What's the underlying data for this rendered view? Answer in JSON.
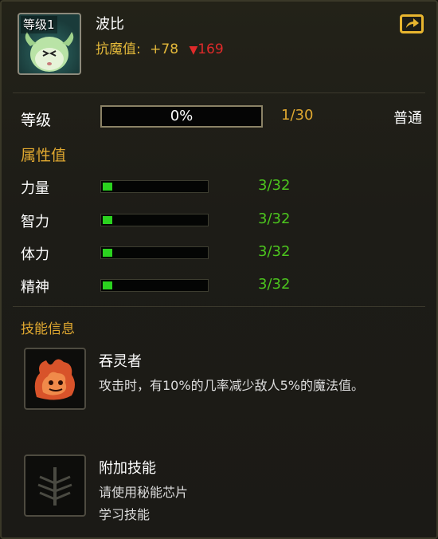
{
  "pet": {
    "level_badge": "等级1",
    "name": "波比",
    "resist_label": "抗魔值:",
    "resist_bonus": "+78",
    "resist_decrease": "169"
  },
  "level": {
    "label": "等级",
    "exp_percent_text": "0%",
    "exp_fraction": 0,
    "progress": "1/30",
    "quality": "普通"
  },
  "attributes": {
    "title": "属性值",
    "items": [
      {
        "label": "力量",
        "value": "3/32",
        "fraction": 0.09375
      },
      {
        "label": "智力",
        "value": "3/32",
        "fraction": 0.09375
      },
      {
        "label": "体力",
        "value": "3/32",
        "fraction": 0.09375
      },
      {
        "label": "精神",
        "value": "3/32",
        "fraction": 0.09375
      }
    ]
  },
  "skills": {
    "title": "技能信息",
    "primary": {
      "name": "吞灵者",
      "description": "攻击时，有10%的几率减少敌人5%的魔法值。",
      "icon": "flame-creature-icon"
    },
    "extra": {
      "name": "附加技能",
      "line1": "请使用秘能芯片",
      "line2": "学习技能",
      "icon": "locked-skill-icon"
    }
  },
  "colors": {
    "gold": "#e0a830",
    "green_value": "#4cc51e",
    "bar_fill": "#2bd21f",
    "red_decrease": "#e02a2a"
  }
}
